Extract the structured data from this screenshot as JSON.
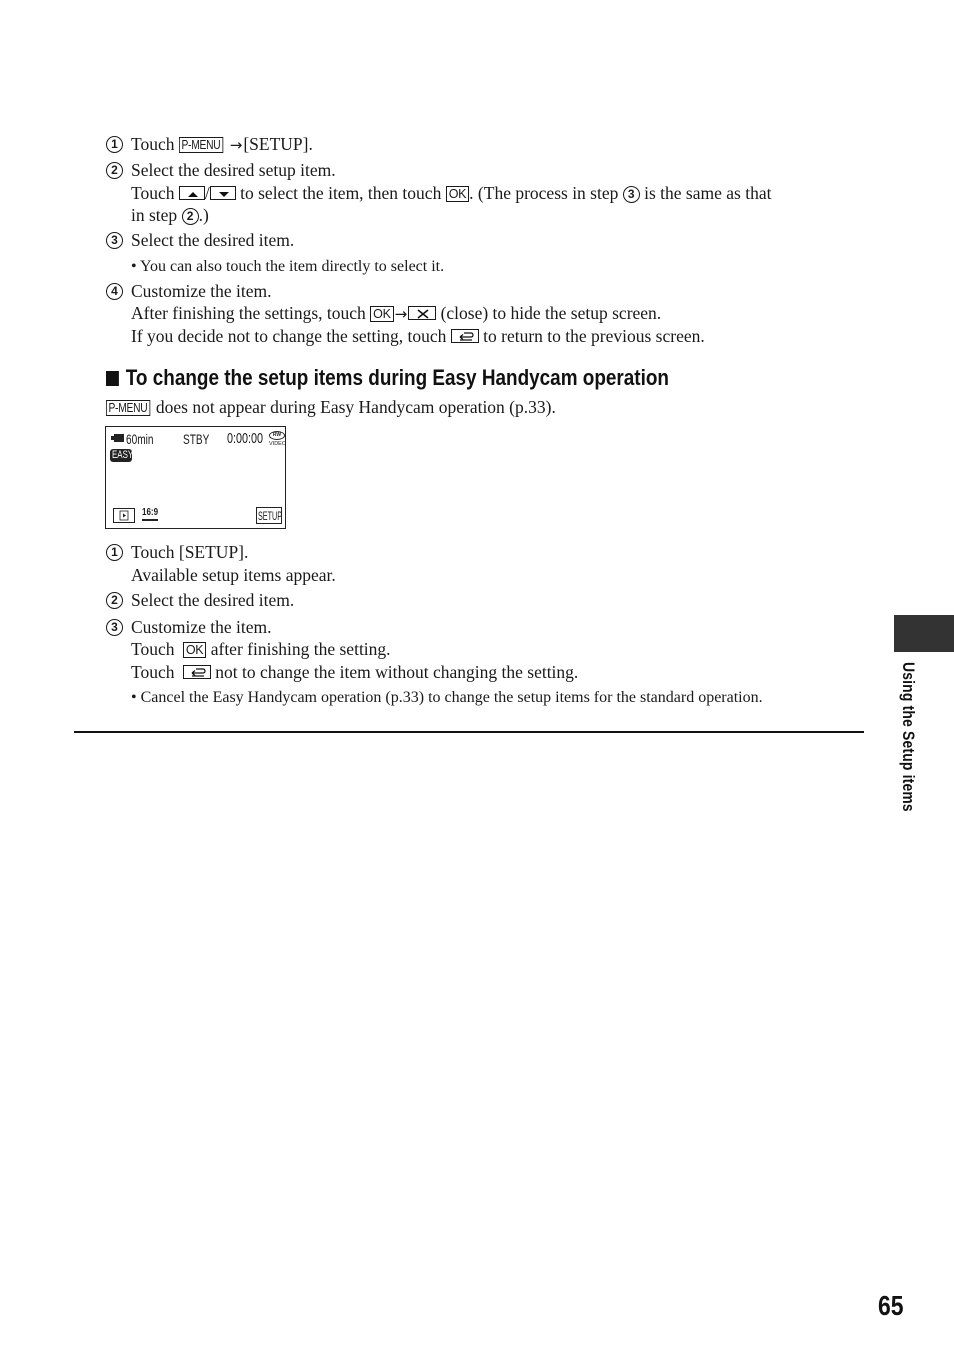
{
  "section1": {
    "steps": [
      {
        "num": "1",
        "pre": "Touch",
        "key": "P-MENU",
        "arrow": "→",
        "post": "[SETUP]."
      },
      {
        "num": "2",
        "text": "Select the desired setup item.",
        "detail": {
          "pre": "Touch",
          "sep": "/",
          "mid": "to select the item, then touch",
          "ok": "OK",
          "post_a": ". (The process in step",
          "ref1": "3",
          "post_b": "is the same as that",
          "line2_pre": "in step",
          "ref2": "2",
          "line2_post": ".)"
        }
      },
      {
        "num": "3",
        "text": "Select the desired item.",
        "note": "You can also touch the item directly to select it."
      },
      {
        "num": "4",
        "text": "Customize the item.",
        "detail1": {
          "pre": "After finishing the settings, touch",
          "ok": "OK",
          "arrow": "→",
          "post": "(close) to hide the setup screen."
        },
        "detail2": {
          "pre": "If you decide not to change the setting, touch",
          "post": "to return to the previous screen."
        }
      }
    ]
  },
  "section2": {
    "heading": "To change the setup items during Easy Handycam operation",
    "intro": {
      "key": "P-MENU",
      "text": "does not appear during Easy Handycam operation (p.33)."
    },
    "lcd": {
      "battery": "60min",
      "status": "STBY",
      "counter": "0:00:00",
      "disc_top": "RW",
      "disc_bottom": "VIDEO",
      "easy": "EASY",
      "aspect": "16:9",
      "setup": "SETUP"
    },
    "steps": [
      {
        "num": "1",
        "text": "Touch [SETUP].",
        "detail": "Available setup items appear."
      },
      {
        "num": "2",
        "text": "Select the desired item."
      },
      {
        "num": "3",
        "text": "Customize the item.",
        "detail1": {
          "pre": "Touch",
          "ok": "OK",
          "post": "after finishing the setting."
        },
        "detail2": {
          "pre": "Touch",
          "post": "not to change the item without changing the setting."
        },
        "note": "Cancel the Easy Handycam operation (p.33) to change the setup items for the standard operation."
      }
    ]
  },
  "side_tab": {
    "label": "Using the Setup items"
  },
  "page_number": "65"
}
